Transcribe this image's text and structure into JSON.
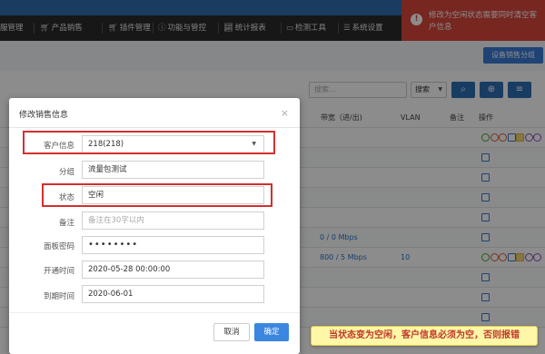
{
  "nav": {
    "items": [
      {
        "icon": "",
        "label": "服管理"
      },
      {
        "icon": "cart-icon",
        "label": "产品销售"
      },
      {
        "icon": "cart-icon",
        "label": "插件管理"
      },
      {
        "icon": "info-icon",
        "label": "功能与管控"
      },
      {
        "icon": "chart-icon",
        "label": "统计报表"
      },
      {
        "icon": "monitor-icon",
        "label": "检测工具"
      },
      {
        "icon": "list-icon",
        "label": "系统设置"
      }
    ]
  },
  "toast": {
    "message": "修改为空闲状态需要同时清空客户信息",
    "color": "#d9453b"
  },
  "toolbar": {
    "group_button": "设备销售分组",
    "search_placeholder": "搜索...",
    "search_select": "搜索"
  },
  "table": {
    "headers": [
      "宽",
      "带宽（进/出)",
      "VLAN",
      "备注",
      "操作"
    ],
    "rows": [
      {
        "bandwidth": "",
        "vlan": "",
        "actions": true
      },
      {
        "bandwidth": "",
        "vlan": "",
        "actions": false
      },
      {
        "bandwidth": "",
        "vlan": "",
        "actions": false
      },
      {
        "bandwidth": "",
        "vlan": "",
        "actions": false
      },
      {
        "bandwidth": "",
        "vlan": "",
        "actions": false
      },
      {
        "bandwidth": "0 / 0 Mbps",
        "vlan": "",
        "actions": false
      },
      {
        "bandwidth": "800 / 5 Mbps",
        "vlan": "10",
        "actions": true
      },
      {
        "bandwidth": "",
        "vlan": "",
        "actions": false
      },
      {
        "bandwidth": "",
        "vlan": "",
        "actions": false
      },
      {
        "bandwidth": "",
        "vlan": "",
        "actions": false
      },
      {
        "bandwidth": "",
        "vlan": "",
        "actions": false
      }
    ]
  },
  "modal": {
    "title": "修改销售信息",
    "close": "×",
    "fields": {
      "customer": {
        "label": "客户信息",
        "value": "218(218)"
      },
      "group": {
        "label": "分组",
        "value": "流量包测试"
      },
      "status": {
        "label": "状态",
        "value": "空闲"
      },
      "remark": {
        "label": "备注",
        "placeholder": "备注在30字以内"
      },
      "panel_password": {
        "label": "面板密码",
        "value": "••••••••"
      },
      "open_time": {
        "label": "开通时间",
        "value": "2020-05-28 00:00:00"
      },
      "expire_time": {
        "label": "到期时间",
        "value": "2020-06-01"
      }
    },
    "cancel": "取消",
    "confirm": "确定"
  },
  "annotation": "当状态变为空闲，客户信息必须为空，否则报错",
  "colors": {
    "primary": "#3a86e0",
    "highlight": "#d32f2f",
    "navbar": "#2a2a2a"
  }
}
